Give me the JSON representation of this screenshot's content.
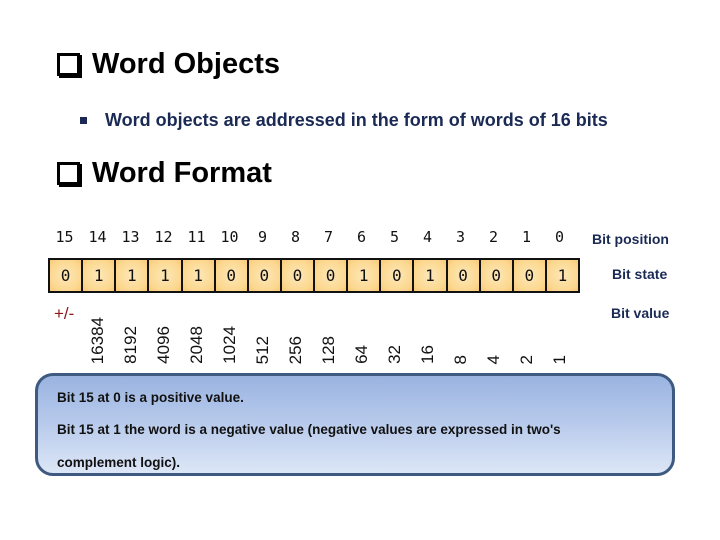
{
  "heading1": {
    "icon": "checkbox-square-icon",
    "text": "Word Objects"
  },
  "bullet": {
    "icon": "square-bullet-icon",
    "text": "Word objects are addressed in the form of words of 16 bits"
  },
  "heading2": {
    "icon": "checkbox-square-icon",
    "text": "Word Format"
  },
  "word_format": {
    "bit_positions": [
      "15",
      "14",
      "13",
      "12",
      "11",
      "10",
      "9",
      "8",
      "7",
      "6",
      "5",
      "4",
      "3",
      "2",
      "1",
      "0"
    ],
    "bit_states": [
      "0",
      "1",
      "1",
      "1",
      "1",
      "0",
      "0",
      "0",
      "0",
      "1",
      "0",
      "1",
      "0",
      "0",
      "0",
      "1"
    ],
    "bit_values": [
      "+/-",
      "16384",
      "8192",
      "4096",
      "2048",
      "1024",
      "512",
      "256",
      "128",
      "64",
      "32",
      "16",
      "8",
      "4",
      "2",
      "1"
    ],
    "labels": {
      "position": "Bit position",
      "state": "Bit state",
      "value": "Bit value"
    }
  },
  "callout": {
    "line1": "Bit 15 at 0 is a positive value.",
    "line2": "Bit 15 at 1 the word is a negative value (negative values are expressed in two's",
    "line3": "complement logic)."
  },
  "colors": {
    "cell_fill": "#fcd78f",
    "heading_blue": "#1a2a55",
    "sign_red": "#8b1a1a",
    "callout_border": "#3e5a80"
  }
}
